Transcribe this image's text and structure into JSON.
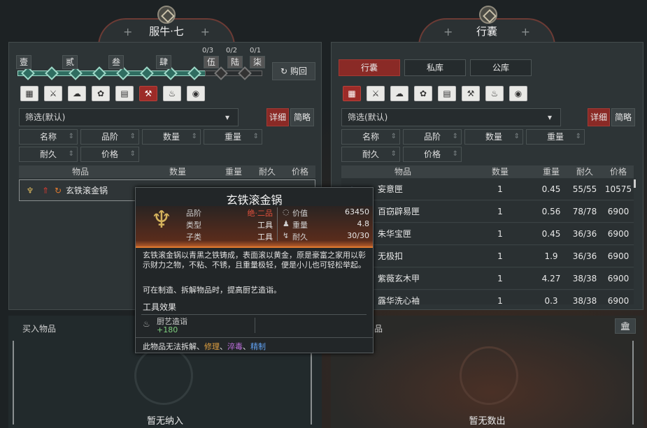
{
  "left": {
    "title": "服牛·七",
    "ranks": [
      "壹",
      "贰",
      "叁",
      "肆",
      "伍",
      "陆",
      "柒"
    ],
    "rank_counts": [
      "0/3",
      "0/2",
      "0/1"
    ],
    "buyback": "购回",
    "filter": "筛选(默认)",
    "detail": "详细",
    "brief": "简略",
    "sorts": [
      "名称",
      "品阶",
      "数量",
      "重量",
      "耐久",
      "价格"
    ],
    "cols": [
      "物品",
      "数量",
      "重量",
      "耐久",
      "价格"
    ],
    "row": {
      "name": "玄铁滚金锅",
      "qty": "1",
      "weight": "4.8",
      "dur": "30/30",
      "price": "63450"
    },
    "buy_title": "买入物品",
    "empty": "暂无纳入"
  },
  "right": {
    "title": "行囊",
    "tabs": [
      "行囊",
      "私库",
      "公库"
    ],
    "filter": "筛选(默认)",
    "detail": "详细",
    "brief": "简略",
    "sorts": [
      "名称",
      "品阶",
      "数量",
      "重量",
      "耐久",
      "价格"
    ],
    "cols": [
      "物品",
      "数量",
      "重量",
      "耐久",
      "价格"
    ],
    "rows": [
      {
        "name": "妄意匣",
        "qty": "1",
        "weight": "0.45",
        "dur": "55/55",
        "price": "10575"
      },
      {
        "name": "百窃辟易匣",
        "qty": "1",
        "weight": "0.56",
        "dur": "78/78",
        "price": "6900"
      },
      {
        "name": "朱华宝匣",
        "qty": "1",
        "weight": "0.45",
        "dur": "36/36",
        "price": "6900"
      },
      {
        "name": "无极扣",
        "qty": "1",
        "weight": "1.9",
        "dur": "36/36",
        "price": "6900"
      },
      {
        "name": "紫薇玄木甲",
        "qty": "1",
        "weight": "4.27",
        "dur": "38/38",
        "price": "6900"
      },
      {
        "name": "露华洗心袖",
        "qty": "1",
        "weight": "0.3",
        "dur": "38/38",
        "price": "6900"
      }
    ],
    "sell_title": "品",
    "empty": "暂无数出"
  },
  "tooltip": {
    "name": "玄铁滚金锅",
    "grade_label": "品阶",
    "grade": "绝·二品",
    "type_label": "类型",
    "type": "工具",
    "sub_label": "子类",
    "sub": "工具",
    "value_label": "价值",
    "value": "63450",
    "weight_label": "重量",
    "weight": "4.8",
    "dur_label": "耐久",
    "dur": "30/30",
    "desc": "玄铁滚金锅以青黑之铁铸成，表面滚以黄金，原是豪富之家用以彰示财力之物，不粘、不锈，且重量极轻，便是小儿也可轻松举起。",
    "use": "可在制造、拆解物品时，提高厨艺造诣。",
    "effect_title": "工具效果",
    "effect_name": "厨艺造诣",
    "effect_val": "+180",
    "footer_pre": "此物品无法",
    "footer_a": "拆解",
    "footer_b": "修理",
    "footer_c": "淬毒",
    "footer_d": "精制"
  },
  "colors": {
    "accent": "#9c2b28",
    "grade": "#e0503c",
    "mint": "#9fd9c8",
    "effect": "#7fd07f"
  }
}
